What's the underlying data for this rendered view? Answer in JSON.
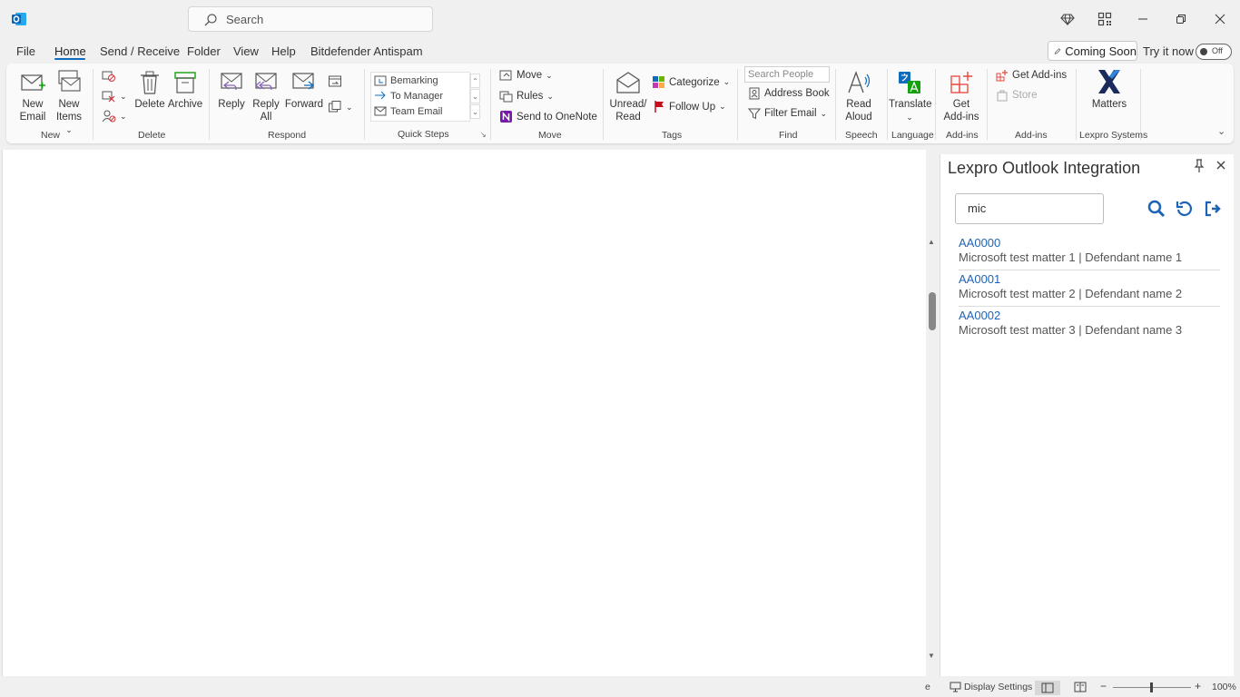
{
  "titlebar": {
    "search_placeholder": "Search"
  },
  "menu": {
    "items": [
      "File",
      "Home",
      "Send / Receive",
      "Folder",
      "View",
      "Help",
      "Bitdefender Antispam"
    ],
    "active": "Home",
    "coming_soon": "Coming Soon",
    "try_now": "Try it now",
    "toggle_label": "Off"
  },
  "ribbon": {
    "new_email": [
      "New",
      "Email"
    ],
    "new_items": [
      "New",
      "Items"
    ],
    "delete": "Delete",
    "archive": "Archive",
    "reply": "Reply",
    "reply_all": [
      "Reply",
      "All"
    ],
    "forward": "Forward",
    "quick_steps": [
      "Bemarking",
      "To Manager",
      "Team Email"
    ],
    "move": "Move",
    "rules": "Rules",
    "send_onenote": "Send to OneNote",
    "unread_read": [
      "Unread/",
      "Read"
    ],
    "categorize": "Categorize",
    "follow_up": "Follow Up",
    "search_people_placeholder": "Search People",
    "address_book": "Address Book",
    "filter_email": "Filter Email",
    "read_aloud": [
      "Read",
      "Aloud"
    ],
    "translate": "Translate",
    "get_addins_big": [
      "Get",
      "Add-ins"
    ],
    "get_addins_small": "Get Add-ins",
    "store": "Store",
    "matters": "Matters",
    "groups": {
      "new": "New",
      "delete": "Delete",
      "respond": "Respond",
      "quick_steps": "Quick Steps",
      "move": "Move",
      "tags": "Tags",
      "find": "Find",
      "speech": "Speech",
      "language": "Language",
      "addins1": "Add-ins",
      "addins2": "Add-ins",
      "lexpro": "Lexpro Systems"
    }
  },
  "taskpane": {
    "title": "Lexpro Outlook Integration",
    "search_value": "mic",
    "results": [
      {
        "code": "AA0000",
        "desc": "Microsoft test matter 1 | Defendant name 1"
      },
      {
        "code": "AA0001",
        "desc": "Microsoft test matter 2 | Defendant name 2"
      },
      {
        "code": "AA0002",
        "desc": "Microsoft test matter 3 | Defendant name 3"
      }
    ]
  },
  "statusbar": {
    "left_char": "e",
    "display_settings": "Display Settings",
    "zoom_minus": "−",
    "zoom_plus": "+",
    "zoom": "100%"
  },
  "colors": {
    "accent": "#0f6cbd",
    "link": "#1f63b5",
    "outlook_blue": "#0364b8",
    "lexpro_navy": "#1b2a5c",
    "addin_red": "#e8453c"
  }
}
